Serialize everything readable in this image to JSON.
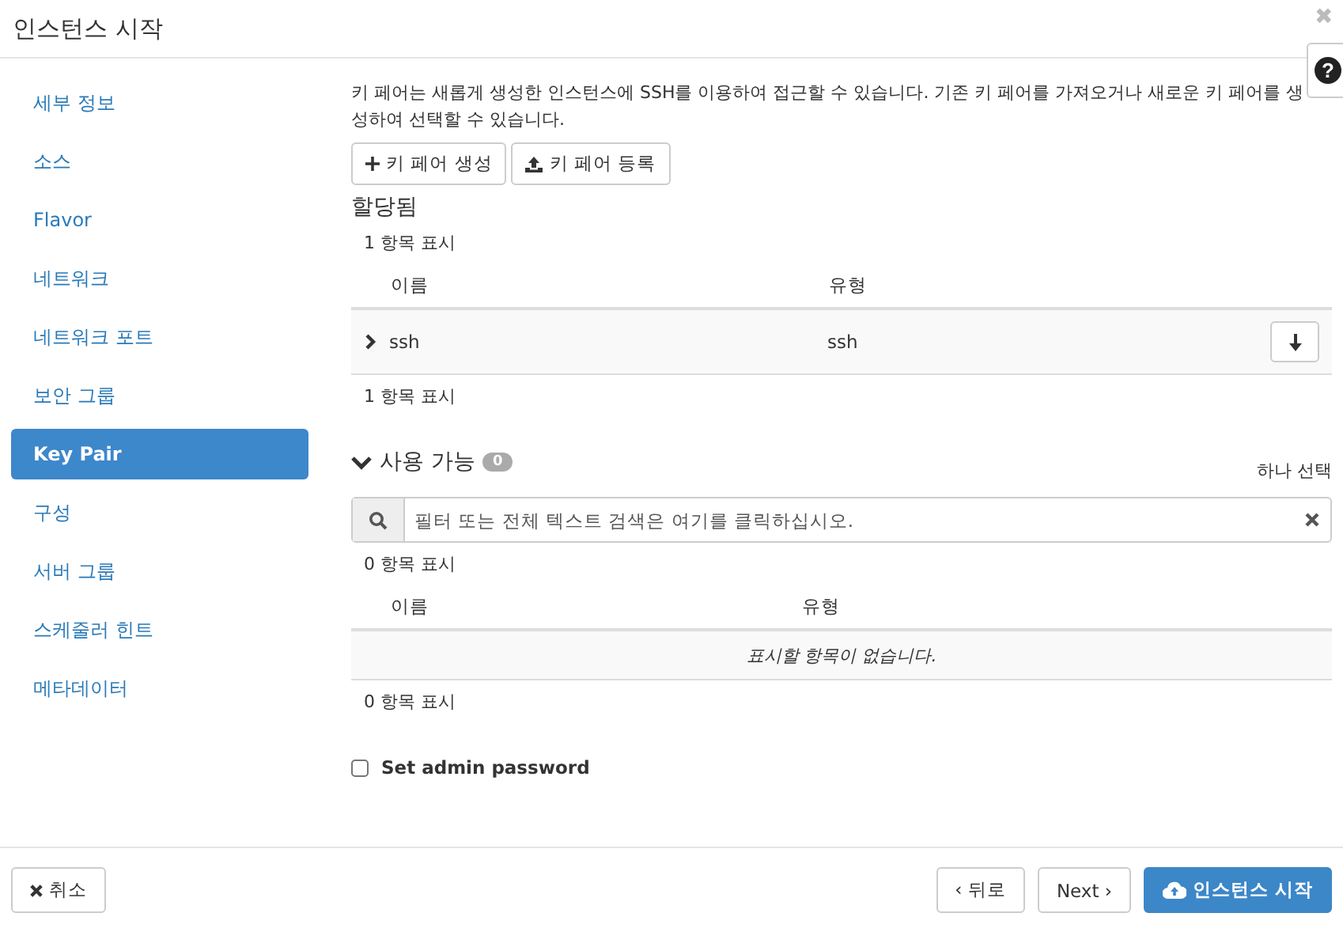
{
  "window": {
    "title": "인스턴스 시작",
    "close": "✖",
    "help": "?"
  },
  "sidebar": {
    "items": [
      {
        "label": "세부 정보",
        "selected": false
      },
      {
        "label": "소스",
        "selected": false
      },
      {
        "label": "Flavor",
        "selected": false
      },
      {
        "label": "네트워크",
        "selected": false
      },
      {
        "label": "네트워크 포트",
        "selected": false
      },
      {
        "label": "보안 그룹",
        "selected": false
      },
      {
        "label": "Key Pair",
        "selected": true
      },
      {
        "label": "구성",
        "selected": false
      },
      {
        "label": "서버 그룹",
        "selected": false
      },
      {
        "label": "스케줄러 힌트",
        "selected": false
      },
      {
        "label": "메타데이터",
        "selected": false
      }
    ]
  },
  "intro": "키 페어는 새롭게 생성한 인스턴스에 SSH를 이용하여 접근할 수 있습니다. 기존 키 페어를 가져오거나 새로운 키 페어를 생성하여 선택할 수 있습니다.",
  "actions": [
    {
      "label": "키 페어 생성",
      "kind": "create"
    },
    {
      "label": "키 페어 등록",
      "kind": "import"
    }
  ],
  "allocated": {
    "title": "할당됨",
    "count_top": "1 항목 표시",
    "columns": [
      "이름",
      "유형"
    ],
    "rows": [
      {
        "name": "ssh",
        "type": "ssh",
        "expanded": false
      }
    ],
    "count_bottom": "1 항목 표시"
  },
  "available": {
    "title": "사용 가능",
    "expanded": true,
    "badge": "0",
    "select_hint": "하나 선택",
    "search": {
      "placeholder": "필터 또는 전체 텍스트 검색은 여기를 클릭하십시오."
    },
    "count_top": "0 항목 표시",
    "columns": [
      "이름",
      "유형"
    ],
    "empty": "표시할 항목이 없습니다.",
    "count_bottom": "0 항목 표시"
  },
  "admin_password": {
    "label": "Set admin password",
    "checked": false
  },
  "footer": {
    "cancel": "취소",
    "back": "‹ 뒤로",
    "next": "Next ›",
    "launch": "인스턴스 시작"
  }
}
